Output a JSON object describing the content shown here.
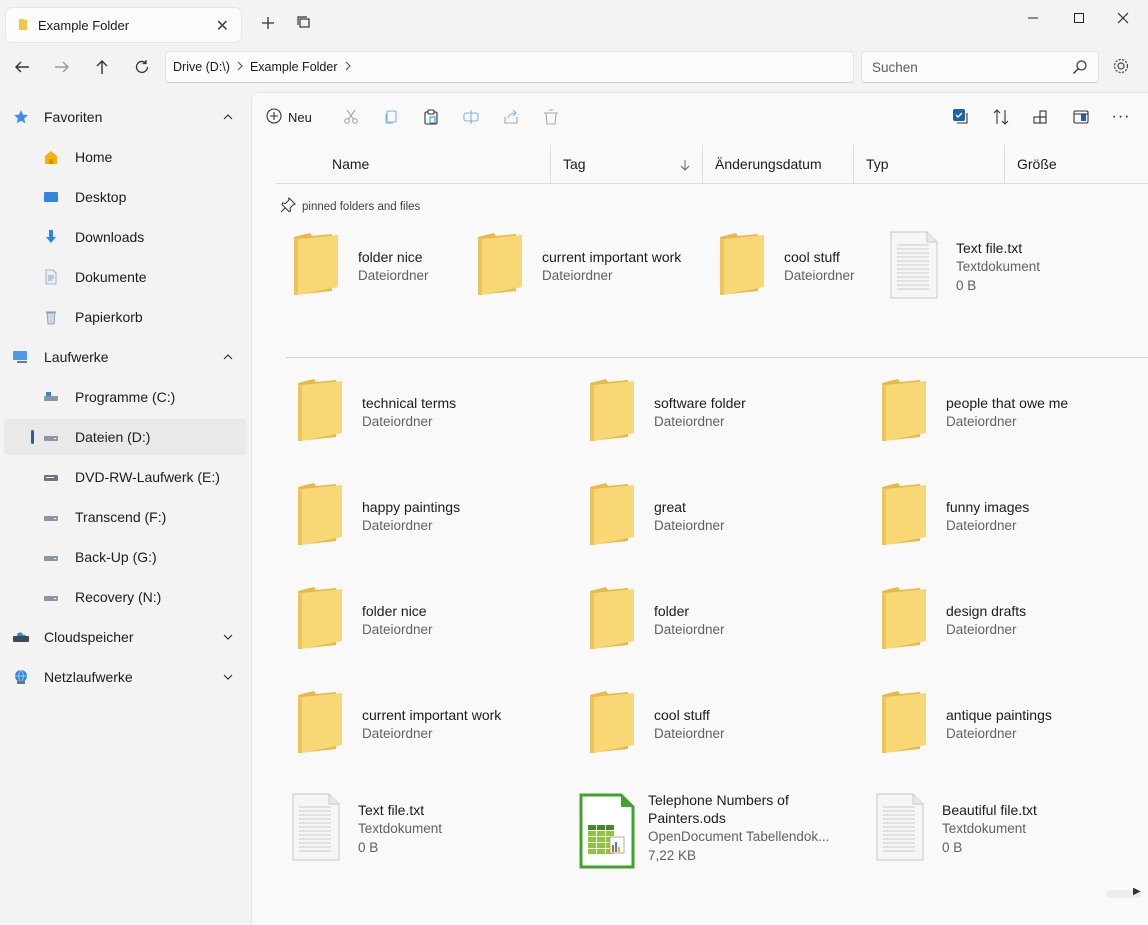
{
  "tab": {
    "title": "Example Folder",
    "close": "✕",
    "new_tab": "+"
  },
  "address": {
    "crumbs": [
      "Drive (D:\\)",
      "Example Folder"
    ]
  },
  "search": {
    "placeholder": "Suchen"
  },
  "sidebar": {
    "sections": [
      {
        "label": "Favoriten",
        "icon": "star-icon",
        "expanded": true
      },
      {
        "label": "Laufwerke",
        "icon": "computer-icon",
        "expanded": true
      },
      {
        "label": "Cloudspeicher",
        "icon": "cloud-drive-icon",
        "expanded": false
      },
      {
        "label": "Netzlaufwerke",
        "icon": "network-icon",
        "expanded": false
      }
    ],
    "favorites": [
      {
        "label": "Home",
        "icon": "home-icon"
      },
      {
        "label": "Desktop",
        "icon": "desktop-icon"
      },
      {
        "label": "Downloads",
        "icon": "download-icon"
      },
      {
        "label": "Dokumente",
        "icon": "document-icon"
      },
      {
        "label": "Papierkorb",
        "icon": "recycle-bin-icon"
      }
    ],
    "drives": [
      {
        "label": "Programme (C:)",
        "icon": "system-drive-icon"
      },
      {
        "label": "Dateien (D:)",
        "icon": "drive-icon",
        "active": true
      },
      {
        "label": "DVD-RW-Laufwerk (E:)",
        "icon": "dvd-drive-icon"
      },
      {
        "label": "Transcend (F:)",
        "icon": "drive-icon"
      },
      {
        "label": "Back-Up (G:)",
        "icon": "drive-icon"
      },
      {
        "label": "Recovery (N:)",
        "icon": "drive-icon"
      }
    ]
  },
  "toolbar": {
    "new_label": "Neu",
    "more": "···"
  },
  "columns": [
    "Name",
    "Tag",
    "Änderungsdatum",
    "Typ",
    "Größe"
  ],
  "pinned": {
    "label": "pinned folders and files",
    "items": [
      {
        "name": "folder nice",
        "type": "Dateiordner",
        "kind": "folder"
      },
      {
        "name": "current important work",
        "type": "Dateiordner",
        "kind": "folder"
      },
      {
        "name": "cool stuff",
        "type": "Dateiordner",
        "kind": "folder"
      },
      {
        "name": "Text file.txt",
        "type": "Textdokument",
        "size": "0 B",
        "kind": "text"
      }
    ]
  },
  "items": [
    {
      "name": "technical terms",
      "type": "Dateiordner",
      "kind": "folder"
    },
    {
      "name": "software folder",
      "type": "Dateiordner",
      "kind": "folder"
    },
    {
      "name": "people that owe me",
      "type": "Dateiordner",
      "kind": "folder"
    },
    {
      "name": "happy paintings",
      "type": "Dateiordner",
      "kind": "folder"
    },
    {
      "name": "great",
      "type": "Dateiordner",
      "kind": "folder"
    },
    {
      "name": "funny images",
      "type": "Dateiordner",
      "kind": "folder"
    },
    {
      "name": "folder nice",
      "type": "Dateiordner",
      "kind": "folder"
    },
    {
      "name": "folder",
      "type": "Dateiordner",
      "kind": "folder"
    },
    {
      "name": "design drafts",
      "type": "Dateiordner",
      "kind": "folder"
    },
    {
      "name": "current important work",
      "type": "Dateiordner",
      "kind": "folder"
    },
    {
      "name": "cool stuff",
      "type": "Dateiordner",
      "kind": "folder"
    },
    {
      "name": "antique paintings",
      "type": "Dateiordner",
      "kind": "folder"
    },
    {
      "name": "Text file.txt",
      "type": "Textdokument",
      "size": "0 B",
      "kind": "text"
    },
    {
      "name": "Telephone Numbers of Painters.ods",
      "type": "OpenDocument Tabellendok...",
      "size": "7,22 KB",
      "kind": "spreadsheet"
    },
    {
      "name": "Beautiful file.txt",
      "type": "Textdokument",
      "size": "0 B",
      "kind": "text"
    }
  ],
  "colors": {
    "accent": "#1f5fae",
    "folder": "#f8d775",
    "folder_dark": "#e8b84a"
  }
}
